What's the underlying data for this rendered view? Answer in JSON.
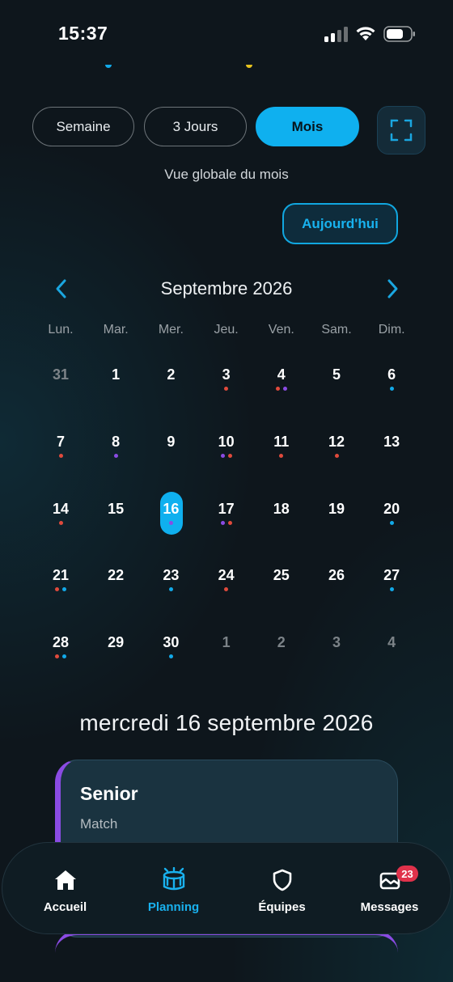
{
  "status_bar": {
    "time": "15:37"
  },
  "view_modes": [
    {
      "label": "Semaine",
      "active": false
    },
    {
      "label": "3 Jours",
      "active": false
    },
    {
      "label": "Mois",
      "active": true
    }
  ],
  "view_subtitle": "Vue globale du mois",
  "today_button": "Aujourd'hui",
  "calendar": {
    "month_title": "Septembre 2026",
    "weekdays": [
      "Lun.",
      "Mar.",
      "Mer.",
      "Jeu.",
      "Ven.",
      "Sam.",
      "Dim."
    ],
    "selected_day": "16",
    "weeks": [
      [
        {
          "n": "31",
          "m": true,
          "d": []
        },
        {
          "n": "1",
          "d": []
        },
        {
          "n": "2",
          "d": []
        },
        {
          "n": "3",
          "d": [
            "red"
          ]
        },
        {
          "n": "4",
          "d": [
            "red",
            "purple"
          ]
        },
        {
          "n": "5",
          "d": []
        },
        {
          "n": "6",
          "d": [
            "blue"
          ]
        }
      ],
      [
        {
          "n": "7",
          "d": [
            "red"
          ]
        },
        {
          "n": "8",
          "d": [
            "purple"
          ]
        },
        {
          "n": "9",
          "d": []
        },
        {
          "n": "10",
          "d": [
            "purple",
            "red"
          ]
        },
        {
          "n": "11",
          "d": [
            "red"
          ]
        },
        {
          "n": "12",
          "d": [
            "red"
          ]
        },
        {
          "n": "13",
          "d": []
        }
      ],
      [
        {
          "n": "14",
          "d": [
            "red"
          ]
        },
        {
          "n": "15",
          "d": []
        },
        {
          "n": "16",
          "d": [
            "purple"
          ]
        },
        {
          "n": "17",
          "d": [
            "purple",
            "red"
          ]
        },
        {
          "n": "18",
          "d": []
        },
        {
          "n": "19",
          "d": []
        },
        {
          "n": "20",
          "d": [
            "blue"
          ]
        }
      ],
      [
        {
          "n": "21",
          "d": [
            "red",
            "blue"
          ]
        },
        {
          "n": "22",
          "d": []
        },
        {
          "n": "23",
          "d": [
            "blue"
          ]
        },
        {
          "n": "24",
          "d": [
            "red"
          ]
        },
        {
          "n": "25",
          "d": []
        },
        {
          "n": "26",
          "d": []
        },
        {
          "n": "27",
          "d": [
            "blue"
          ]
        }
      ],
      [
        {
          "n": "28",
          "d": [
            "red",
            "blue"
          ]
        },
        {
          "n": "29",
          "d": []
        },
        {
          "n": "30",
          "d": [
            "blue"
          ]
        },
        {
          "n": "1",
          "m": true,
          "d": []
        },
        {
          "n": "2",
          "m": true,
          "d": []
        },
        {
          "n": "3",
          "m": true,
          "d": []
        },
        {
          "n": "4",
          "m": true,
          "d": []
        }
      ]
    ]
  },
  "selected_date_label": "mercredi 16 septembre 2026",
  "event": {
    "title": "Senior",
    "type": "Match"
  },
  "tabbar": [
    {
      "label": "Accueil",
      "icon": "home-icon",
      "active": false
    },
    {
      "label": "Planning",
      "icon": "planning-icon",
      "active": true
    },
    {
      "label": "Équipes",
      "icon": "shield-icon",
      "active": false
    },
    {
      "label": "Messages",
      "icon": "messages-icon",
      "active": false,
      "badge": "23"
    }
  ],
  "colors": {
    "accent": "#0fb0ef",
    "dot_red": "#e04a3c",
    "dot_purple": "#8a4be3",
    "dot_blue": "#12a9e8",
    "badge": "#e0324b"
  }
}
